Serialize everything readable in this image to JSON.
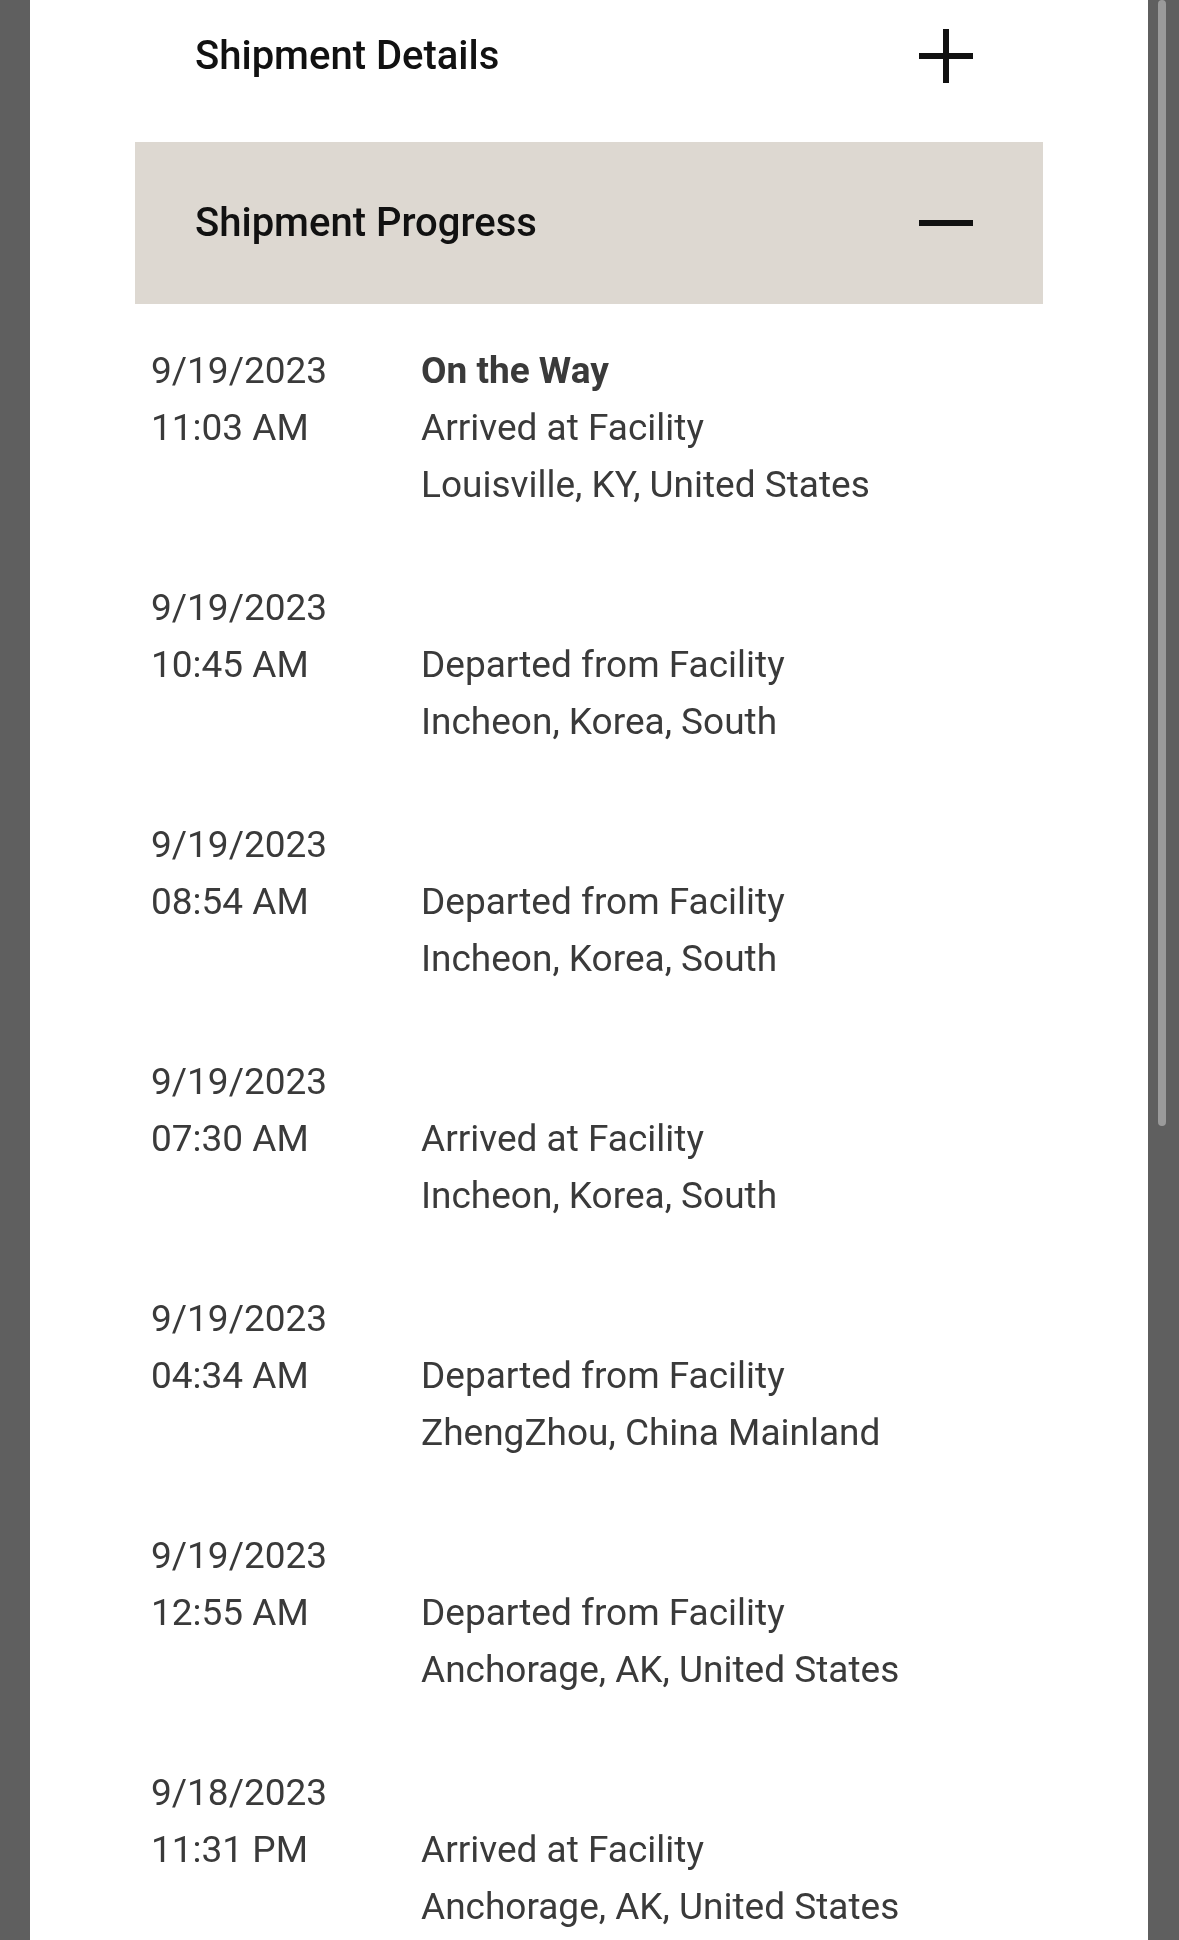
{
  "sections": [
    {
      "title": "Shipment Details",
      "expanded": false
    },
    {
      "title": "Shipment Progress",
      "expanded": true
    }
  ],
  "events": [
    {
      "date": "9/19/2023",
      "time": "11:03 AM",
      "status": "On the Way",
      "description": "Arrived at Facility",
      "location": "Louisville, KY, United States"
    },
    {
      "date": "9/19/2023",
      "time": "10:45 AM",
      "description": "Departed from Facility",
      "location": "Incheon, Korea, South"
    },
    {
      "date": "9/19/2023",
      "time": "08:54 AM",
      "description": "Departed from Facility",
      "location": "Incheon, Korea, South"
    },
    {
      "date": "9/19/2023",
      "time": "07:30 AM",
      "description": "Arrived at Facility",
      "location": "Incheon, Korea, South"
    },
    {
      "date": "9/19/2023",
      "time": "04:34 AM",
      "description": "Departed from Facility",
      "location": "ZhengZhou, China Mainland"
    },
    {
      "date": "9/19/2023",
      "time": "12:55 AM",
      "description": "Departed from Facility",
      "location": "Anchorage, AK, United States"
    },
    {
      "date": "9/18/2023",
      "time": "11:31 PM",
      "description": "Arrived at Facility",
      "location": "Anchorage, AK, United States"
    }
  ]
}
